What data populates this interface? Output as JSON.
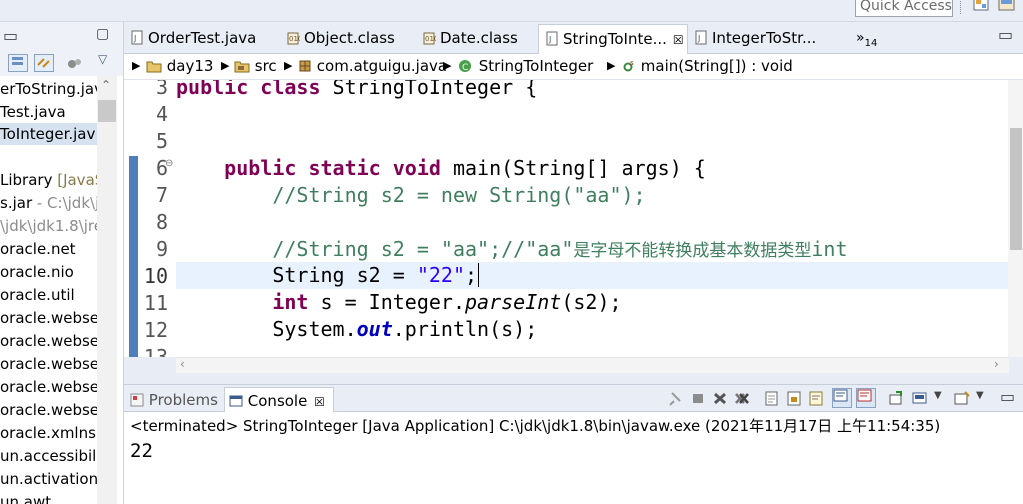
{
  "toolbar": {
    "quick_access_placeholder": "Quick Access"
  },
  "package_explorer": {
    "items": [
      {
        "text": "erToString.jav",
        "selected": false
      },
      {
        "text": "Test.java",
        "selected": false
      },
      {
        "text": "ToInteger.jav",
        "selected": true
      },
      {
        "text": "",
        "selected": false
      },
      {
        "text": " Library ",
        "extra": "[JavaS"
      },
      {
        "text": "s.jar",
        "extra": " - C:\\jdk\\j"
      },
      {
        "text": "\\jdk\\jdk1.8\\jre",
        "gray": true
      },
      {
        "text": "oracle.net"
      },
      {
        "text": "oracle.nio"
      },
      {
        "text": "oracle.util"
      },
      {
        "text": "oracle.webserv"
      },
      {
        "text": "oracle.webserv"
      },
      {
        "text": "oracle.webserv"
      },
      {
        "text": "oracle.webserv"
      },
      {
        "text": "oracle.webserv"
      },
      {
        "text": "oracle.xmlns.ir"
      },
      {
        "text": "un.accessibili"
      },
      {
        "text": "un.activation."
      },
      {
        "text": "un.awt"
      }
    ]
  },
  "editor_tabs": [
    {
      "label": "OrderTest.java",
      "icon": "java-file-icon",
      "active": false
    },
    {
      "label": "Object.class",
      "icon": "class-file-icon",
      "active": false
    },
    {
      "label": "Date.class",
      "icon": "class-file-icon",
      "active": false
    },
    {
      "label": "StringToInte...",
      "icon": "java-file-icon",
      "active": true,
      "close": "☒"
    },
    {
      "label": "IntegerToStr...",
      "icon": "java-file-icon",
      "active": false
    }
  ],
  "overflow_tabs": {
    "label": "»",
    "count": "14"
  },
  "breadcrumb": {
    "project": "day13",
    "folder": "src",
    "package": "com.atguigu.java",
    "class": "StringToInteger",
    "method": "main(String[]) : void"
  },
  "code": {
    "line_numbers": [
      "3",
      "4",
      "5",
      "6",
      "7",
      "8",
      "9",
      "10",
      "11",
      "12",
      "13"
    ],
    "current_line": "10",
    "lines": {
      "l3_kw1": "public",
      "l3_kw2": "class",
      "l3_name": " StringToInteger {",
      "l6_kw1": "public",
      "l6_kw2": "static",
      "l6_kw3": "void",
      "l6_rest": " main(String[] args) {",
      "l7": "//String s2 = new String(\"aa\");",
      "l9_a": "//String s2 = \"aa\";//\"aa\"",
      "l9_cjk": "是字母不能转换成基本数据类型",
      "l9_b": "int",
      "l10_a": "String s2 = ",
      "l10_str": "\"22\"",
      "l10_b": ";",
      "l11_kw": "int",
      "l11_a": " s = Integer.",
      "l11_m": "parseInt",
      "l11_b": "(s2);",
      "l12_a": "System.",
      "l12_fld": "out",
      "l12_b": ".println(s);"
    }
  },
  "console_tabs": {
    "problems": "Problems",
    "console": "Console",
    "console_close": "☒"
  },
  "console": {
    "status": "<terminated> StringToInteger [Java Application] C:\\jdk\\jdk1.8\\bin\\javaw.exe (2021年11月17日 上午11:54:35)",
    "output": "22"
  },
  "colors": {
    "keyword": "#7f0055",
    "comment": "#3f7f5f",
    "string": "#2a00ff",
    "current_line": "#e8f2fe"
  }
}
